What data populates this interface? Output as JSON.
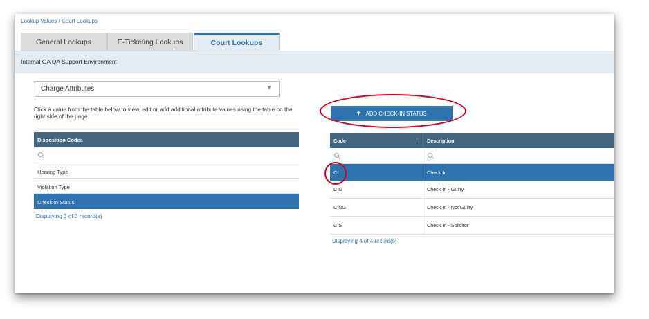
{
  "breadcrumb": "Lookup Values / Court Lookups",
  "tabs": [
    {
      "label": "General Lookups"
    },
    {
      "label": "E-Ticketing Lookups"
    },
    {
      "label": "Court Lookups",
      "active": true
    }
  ],
  "environment": "Internal GA QA Support Environment",
  "attribute_select": {
    "value": "Charge Attributes"
  },
  "hint_text": "Click a value from the table below to view, edit or add additional attribute values using the table on the right side of the page.",
  "left_table": {
    "header": "Disposition Codes",
    "rows": [
      "Hearing Type",
      "Violation Type",
      "Check-In Status"
    ],
    "selected_index": 2,
    "footer": "Displaying 3 of 3 record(s)"
  },
  "add_button": {
    "label": "ADD CHECK-IN STATUS",
    "icon": "plus-icon"
  },
  "right_table": {
    "columns": [
      "Code",
      "Description"
    ],
    "sort": {
      "column": "Code",
      "direction": "ascending"
    },
    "rows": [
      {
        "code": "CI",
        "description": "Check In"
      },
      {
        "code": "CIG",
        "description": "Check In - Guilty"
      },
      {
        "code": "CING",
        "description": "Check In - Not Guilty"
      },
      {
        "code": "CIS",
        "description": "Check In - Solicitor"
      }
    ],
    "selected_index": 0,
    "footer": "Displaying 4 of 4 record(s)"
  },
  "colors": {
    "accent": "#2e73b0",
    "header": "#43657f",
    "highlight_annotation": "#d0021b"
  }
}
